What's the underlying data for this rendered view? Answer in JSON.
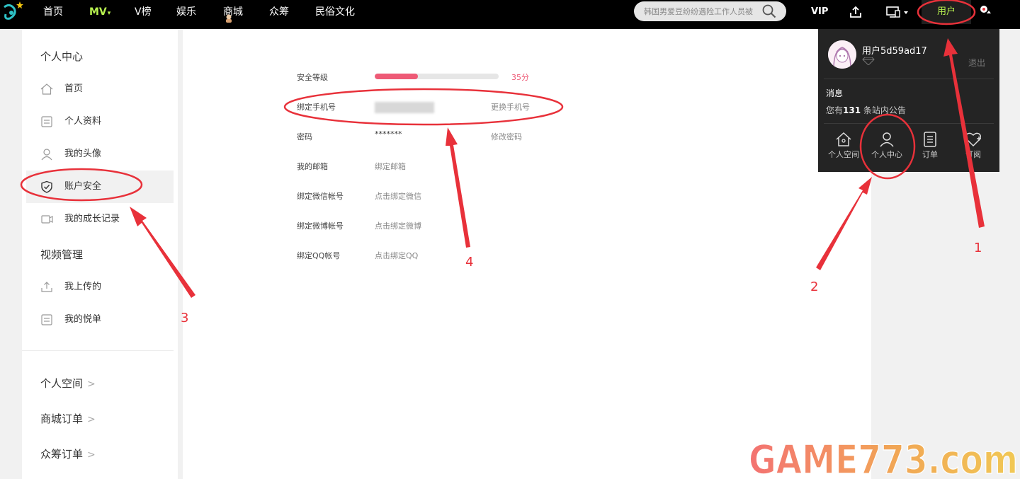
{
  "topbar": {
    "nav": [
      {
        "label": "首页"
      },
      {
        "label": "MV"
      },
      {
        "label": "V榜"
      },
      {
        "label": "娱乐"
      },
      {
        "label": "商城"
      },
      {
        "label": "众筹"
      },
      {
        "label": "民俗文化"
      }
    ],
    "search_placeholder": "韩国男爱豆纷纷遇险工作人员被",
    "vip_label": "VIP",
    "user_label": "用户"
  },
  "sidebar": {
    "personal_center_heading": "个人中心",
    "personal_items": [
      {
        "label": "首页",
        "icon": "home-icon"
      },
      {
        "label": "个人资料",
        "icon": "profile-icon"
      },
      {
        "label": "我的头像",
        "icon": "avatar-icon"
      },
      {
        "label": "账户安全",
        "icon": "shield-icon",
        "active": true
      },
      {
        "label": "我的成长记录",
        "icon": "growth-icon"
      }
    ],
    "video_heading": "视频管理",
    "video_items": [
      {
        "label": "我上传的",
        "icon": "upload-icon"
      },
      {
        "label": "我的悦单",
        "icon": "playlist-icon"
      }
    ],
    "links": [
      {
        "label": "个人空间"
      },
      {
        "label": "商城订单"
      },
      {
        "label": "众筹订单"
      }
    ]
  },
  "security": {
    "level_label": "安全等级",
    "level_score": "35分",
    "level_fraction": 0.35,
    "rows": [
      {
        "label": "绑定手机号",
        "value": "",
        "action": "更换手机号"
      },
      {
        "label": "密码",
        "value": "*******",
        "action": "修改密码"
      },
      {
        "label": "我的邮箱",
        "value": "绑定邮箱",
        "action": ""
      },
      {
        "label": "绑定微信帐号",
        "value": "点击绑定微信",
        "action": ""
      },
      {
        "label": "绑定微博帐号",
        "value": "点击绑定微博",
        "action": ""
      },
      {
        "label": "绑定QQ帐号",
        "value": "点击绑定QQ",
        "action": ""
      }
    ]
  },
  "user_panel": {
    "username": "用户5d59ad17",
    "logout": "退出",
    "message_title": "消息",
    "message_prefix": "您有",
    "message_count": "131",
    "message_suffix": " 条站内公告",
    "buttons": [
      {
        "label": "个人空间",
        "icon": "home-icon"
      },
      {
        "label": "个人中心",
        "icon": "user-icon"
      },
      {
        "label": "订单",
        "icon": "order-icon"
      },
      {
        "label": "订阅",
        "icon": "subscribe-icon"
      }
    ]
  },
  "annotations": {
    "numbers": [
      "1",
      "2",
      "3",
      "4"
    ]
  },
  "watermark": {
    "text": "GAME773.com"
  },
  "colors": {
    "accent_green": "#b8f250",
    "score_pink": "#ee5a76",
    "annotation_red": "#e8313a"
  }
}
